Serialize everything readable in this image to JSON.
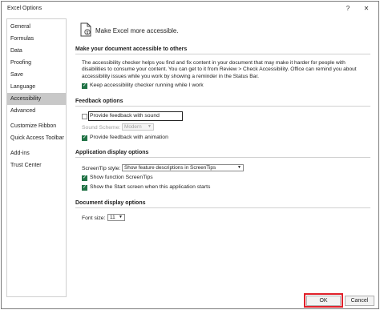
{
  "window": {
    "title": "Excel Options",
    "help_glyph": "?",
    "close_glyph": "✕"
  },
  "sidebar": {
    "items": [
      {
        "label": "General"
      },
      {
        "label": "Formulas"
      },
      {
        "label": "Data"
      },
      {
        "label": "Proofing"
      },
      {
        "label": "Save"
      },
      {
        "label": "Language"
      },
      {
        "label": "Accessibility",
        "active": true
      },
      {
        "label": "Advanced"
      },
      {
        "label": "Customize Ribbon"
      },
      {
        "label": "Quick Access Toolbar"
      },
      {
        "label": "Add-ins"
      },
      {
        "label": "Trust Center"
      }
    ]
  },
  "main": {
    "header": "Make Excel more accessible.",
    "sections": {
      "doc_accessible": {
        "title": "Make your document accessible to others",
        "description": "The accessibility checker helps you find and fix content in your document that may make it harder for people with disabilities to consume your content. You can get to it from Review > Check Accessibility. Office can remind you about accessibility issues while you work by showing a reminder in the Status Bar.",
        "keep_checker_label": "Keep accessibility checker running while I work",
        "keep_checker_checked": true
      },
      "feedback": {
        "title": "Feedback options",
        "sound_label": "Provide feedback with sound",
        "sound_checked": false,
        "sound_scheme_label": "Sound Scheme:",
        "sound_scheme_value": "Modern",
        "animation_label": "Provide feedback with animation",
        "animation_checked": true
      },
      "app_display": {
        "title": "Application display options",
        "screentip_label": "ScreenTip style:",
        "screentip_value": "Show feature descriptions in ScreenTips",
        "function_tips_label": "Show function ScreenTips",
        "function_tips_checked": true,
        "start_screen_label": "Show the Start screen when this application starts",
        "start_screen_checked": true
      },
      "doc_display": {
        "title": "Document display options",
        "font_size_label": "Font size:",
        "font_size_value": "11"
      }
    }
  },
  "footer": {
    "ok_label": "OK",
    "cancel_label": "Cancel"
  },
  "colors": {
    "accent_green": "#217346",
    "highlight_red": "#e0202a",
    "active_sidebar": "#c8c8c8"
  }
}
